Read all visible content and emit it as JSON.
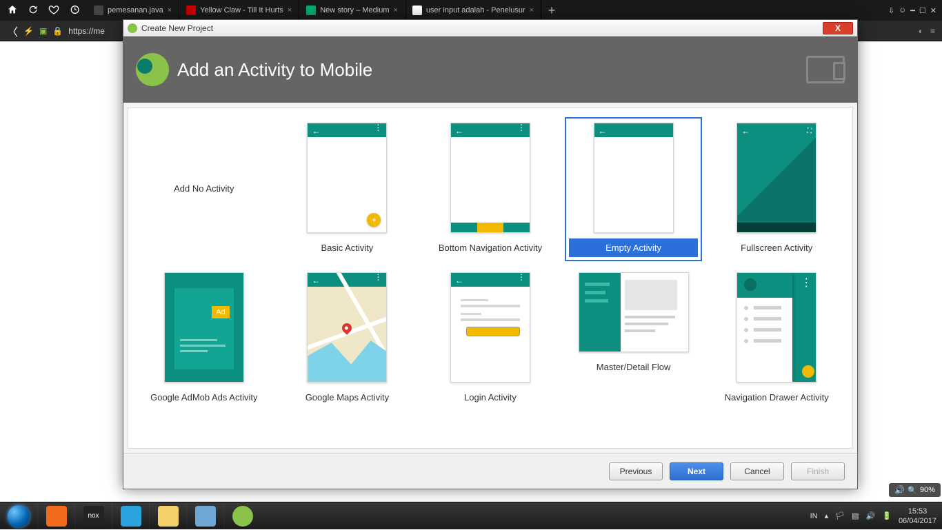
{
  "browser": {
    "url_display": "https://me",
    "tabs": [
      {
        "title": "pemesanan.java"
      },
      {
        "title": "Yellow Claw - Till It Hurts"
      },
      {
        "title": "New story – Medium"
      },
      {
        "title": "user input adalah - Penelusur"
      }
    ]
  },
  "dialog": {
    "window_title": "Create New Project",
    "heading": "Add an Activity to Mobile",
    "templates": [
      {
        "id": "none",
        "label": "Add No Activity"
      },
      {
        "id": "basic",
        "label": "Basic Activity"
      },
      {
        "id": "bottomnav",
        "label": "Bottom Navigation Activity"
      },
      {
        "id": "empty",
        "label": "Empty Activity",
        "selected": true
      },
      {
        "id": "fullscreen",
        "label": "Fullscreen Activity"
      },
      {
        "id": "admob",
        "label": "Google AdMob Ads Activity"
      },
      {
        "id": "maps",
        "label": "Google Maps Activity"
      },
      {
        "id": "login",
        "label": "Login Activity"
      },
      {
        "id": "masterdet",
        "label": "Master/Detail Flow"
      },
      {
        "id": "navdrawer",
        "label": "Navigation Drawer Activity"
      }
    ],
    "buttons": {
      "previous": "Previous",
      "next": "Next",
      "cancel": "Cancel",
      "finish": "Finish"
    }
  },
  "overlay": {
    "zoom_label": "90%"
  },
  "taskbar": {
    "lang": "IN",
    "time": "15:53",
    "date": "06/04/2017"
  },
  "admob_badge": "Ad"
}
